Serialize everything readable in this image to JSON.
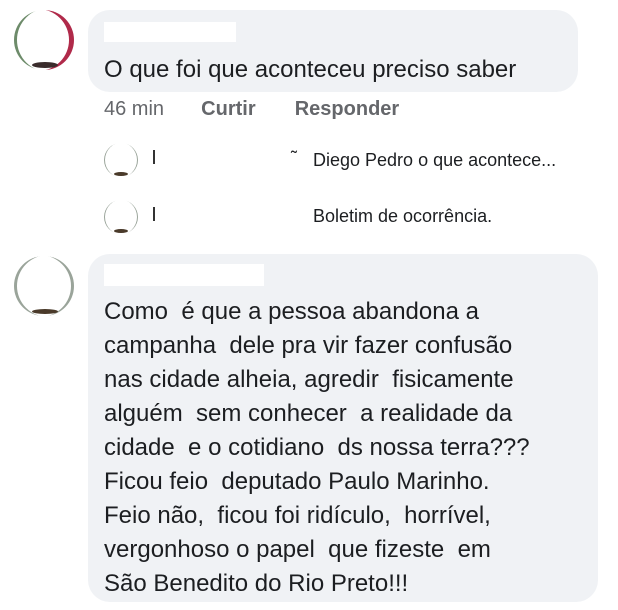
{
  "comments": [
    {
      "text": "O que foi que aconteceu preciso saber",
      "time": "46 min",
      "actions": {
        "like": "Curtir",
        "reply": "Responder"
      }
    },
    {
      "lines": [
        "Como  é que a pessoa abandona a",
        "campanha  dele pra vir fazer confusão",
        "nas cidade alheia, agredir  fisicamente",
        "alguém  sem conhecer  a realidade da",
        "cidade  e o cotidiano  ds nossa terra???",
        "Ficou feio  deputado Paulo Marinho.",
        "Feio não,  ficou foi ridículo,  horrível,",
        "vergonhoso o papel  que fizeste  em",
        "São Benedito do Rio Preto!!!"
      ]
    }
  ],
  "replies": [
    {
      "name_fragment": "˜",
      "preview": "Diego Pedro o que acontece..."
    },
    {
      "preview": "Boletim de ocorrência."
    }
  ]
}
